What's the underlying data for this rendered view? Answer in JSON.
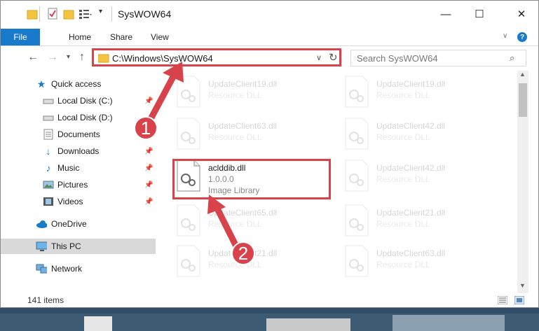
{
  "window": {
    "title": "SysWOW64",
    "controls": [
      "—",
      "☐",
      "✕"
    ]
  },
  "ribbon": {
    "file_tab": "File",
    "tabs": [
      "Home",
      "Share",
      "View"
    ]
  },
  "navbar": {
    "address": "C:\\Windows\\SysWOW64",
    "search_placeholder": "Search SysWOW64"
  },
  "sidebar": {
    "items": [
      {
        "label": "Quick access",
        "icon": "star-icon"
      },
      {
        "label": "Local Disk (C:)",
        "icon": "drive-icon",
        "pinned": true
      },
      {
        "label": "Local Disk (D:)",
        "icon": "drive-icon"
      },
      {
        "label": "Documents",
        "icon": "documents-icon",
        "pinned": true
      },
      {
        "label": "Downloads",
        "icon": "download-icon",
        "pinned": true
      },
      {
        "label": "Music",
        "icon": "music-icon",
        "pinned": true
      },
      {
        "label": "Pictures",
        "icon": "pictures-icon",
        "pinned": true
      },
      {
        "label": "Videos",
        "icon": "videos-icon",
        "pinned": true
      },
      {
        "label": "OneDrive",
        "icon": "cloud-icon"
      },
      {
        "label": "This PC",
        "icon": "computer-icon",
        "selected": true
      },
      {
        "label": "Network",
        "icon": "network-icon"
      }
    ]
  },
  "files": {
    "left": [
      {
        "name": "UpdateClient19.dll",
        "type": "Resource DLL"
      },
      {
        "name": "UpdateClient63.dll",
        "type": "Resource DLL"
      },
      {
        "name": "aclddib.dll",
        "version": "1.0.0.0",
        "type": "Image Library"
      },
      {
        "name": "UpdateClient65.dll",
        "type": "Resource DLL"
      },
      {
        "name": "UpdateClient21.dll",
        "type": "Resource DLL"
      }
    ],
    "right": [
      {
        "name": "UpdateClient19.dll",
        "type": "Resource DLL"
      },
      {
        "name": "UpdateClient42.dll",
        "type": "Resource DLL"
      },
      {
        "name": "UpdateClient42.dll",
        "type": "Resource DLL"
      },
      {
        "name": "UpdateClient21.dll",
        "type": "Resource DLL"
      },
      {
        "name": "UpdateClient63.dll",
        "type": "Resource DLL"
      }
    ]
  },
  "status": {
    "item_count": "141 items"
  },
  "annotations": {
    "step1": "1",
    "step2": "2"
  },
  "colors": {
    "accent": "#1979ca",
    "highlight": "#d8424b"
  }
}
